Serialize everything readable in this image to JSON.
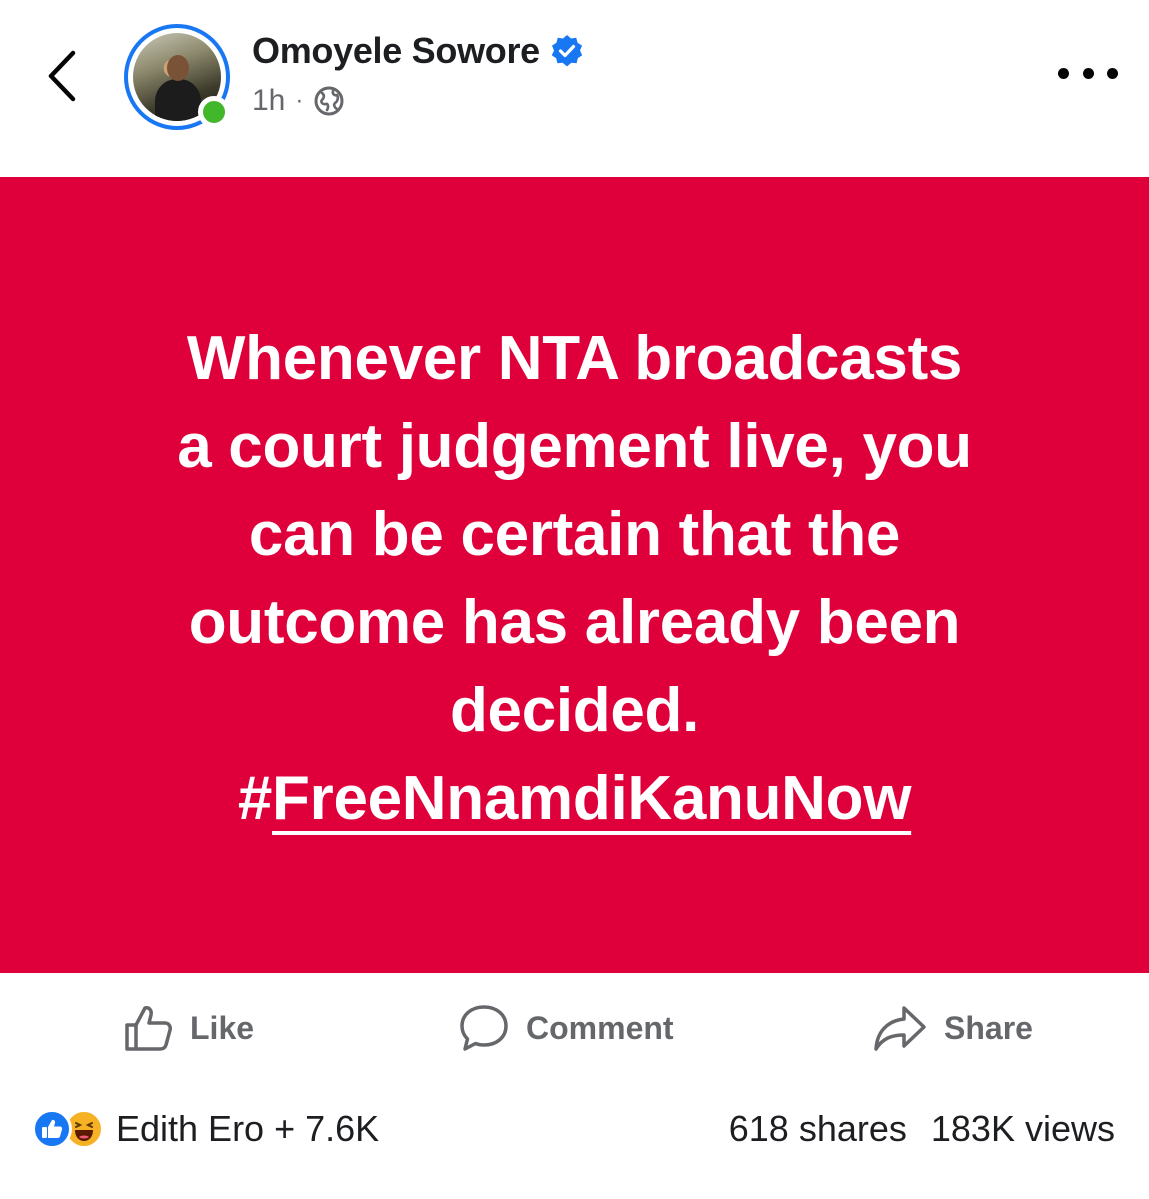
{
  "header": {
    "back_icon": "chevron-left-icon",
    "author_name": "Omoyele Sowore",
    "verified_icon": "verified-badge-icon",
    "time": "1h",
    "separator": "·",
    "audience_icon": "globe-icon",
    "more_icon": "more-horizontal-icon",
    "online": true
  },
  "post": {
    "background_color": "#df003b",
    "text_color": "#ffffff",
    "lines": [
      "Whenever NTA broadcasts",
      "a court judgement live, you",
      "can be certain that the",
      "outcome has already been",
      "decided."
    ],
    "hashtag_symbol": "#",
    "hashtag_text": "FreeNnamdiKanuNow"
  },
  "actions": {
    "like_label": "Like",
    "comment_label": "Comment",
    "share_label": "Share"
  },
  "stats": {
    "reactions": [
      "like",
      "haha"
    ],
    "reactor_summary": "Edith Ero + 7.6K",
    "shares": "618 shares",
    "views": "183K views"
  },
  "colors": {
    "brand_blue": "#1877f2",
    "online_green": "#42b72a",
    "muted_text": "#65676b",
    "haha_yellow": "#f7b125"
  }
}
